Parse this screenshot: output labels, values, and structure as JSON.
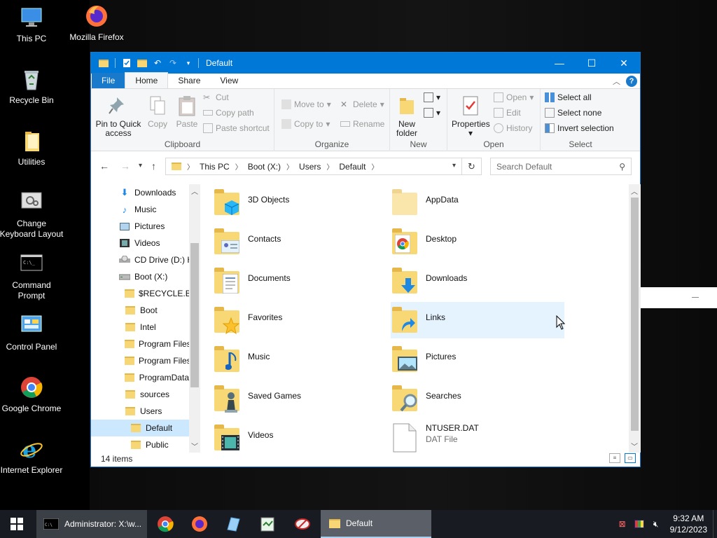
{
  "desktop": {
    "icons": [
      {
        "label": "This PC"
      },
      {
        "label": "Mozilla Firefox"
      },
      {
        "label": "Recycle Bin"
      },
      {
        "label": "Utilities"
      },
      {
        "label": "Change Keyboard Layout"
      },
      {
        "label": "Command Prompt"
      },
      {
        "label": "Control Panel"
      },
      {
        "label": "Google Chrome"
      },
      {
        "label": "Internet Explorer"
      }
    ]
  },
  "window": {
    "title": "Default",
    "controls": {
      "minimize": "—",
      "maximize": "☐",
      "close": "✕"
    }
  },
  "ribbon": {
    "tabs": [
      "File",
      "Home",
      "Share",
      "View"
    ],
    "active_tab": "Home",
    "clipboard": {
      "pin": "Pin to Quick access",
      "pin_line1": "Pin to Quick",
      "pin_line2": "access",
      "copy": "Copy",
      "paste": "Paste",
      "cut": "Cut",
      "copy_path": "Copy path",
      "paste_shortcut": "Paste shortcut",
      "group": "Clipboard"
    },
    "organize": {
      "move_to": "Move to",
      "copy_to": "Copy to",
      "delete": "Delete",
      "rename": "Rename",
      "group": "Organize"
    },
    "new": {
      "new_folder_line1": "New",
      "new_folder_line2": "folder",
      "group": "New"
    },
    "open": {
      "properties": "Properties",
      "open": "Open",
      "edit": "Edit",
      "history": "History",
      "group": "Open"
    },
    "select": {
      "select_all": "Select all",
      "select_none": "Select none",
      "invert": "Invert selection",
      "group": "Select"
    }
  },
  "address": {
    "crumbs": [
      "This PC",
      "Boot (X:)",
      "Users",
      "Default"
    ],
    "search_placeholder": "Search Default"
  },
  "nav_pane": {
    "items": [
      {
        "label": "Downloads",
        "icon": "download-arrow"
      },
      {
        "label": "Music",
        "icon": "music-note"
      },
      {
        "label": "Pictures",
        "icon": "picture"
      },
      {
        "label": "Videos",
        "icon": "film"
      },
      {
        "label": "CD Drive (D:) H",
        "icon": "cd-drive"
      },
      {
        "label": "Boot (X:)",
        "icon": "drive"
      },
      {
        "label": "$RECYCLE.BIN",
        "icon": "folder"
      },
      {
        "label": "Boot",
        "icon": "folder"
      },
      {
        "label": "Intel",
        "icon": "folder"
      },
      {
        "label": "Program Files",
        "icon": "folder"
      },
      {
        "label": "Program Files",
        "icon": "folder"
      },
      {
        "label": "ProgramData",
        "icon": "folder"
      },
      {
        "label": "sources",
        "icon": "folder"
      },
      {
        "label": "Users",
        "icon": "folder"
      },
      {
        "label": "Default",
        "icon": "folder",
        "selected": true
      },
      {
        "label": "Public",
        "icon": "folder"
      }
    ]
  },
  "content": {
    "items": [
      {
        "name": "3D Objects",
        "overlay": "cube"
      },
      {
        "name": "AppData",
        "overlay": "none"
      },
      {
        "name": "Contacts",
        "overlay": "contact-card"
      },
      {
        "name": "Desktop",
        "overlay": "chrome"
      },
      {
        "name": "Documents",
        "overlay": "document"
      },
      {
        "name": "Downloads",
        "overlay": "download-arrow"
      },
      {
        "name": "Favorites",
        "overlay": "star"
      },
      {
        "name": "Links",
        "overlay": "shortcut-arrow"
      },
      {
        "name": "Music",
        "overlay": "music-note"
      },
      {
        "name": "Pictures",
        "overlay": "picture"
      },
      {
        "name": "Saved Games",
        "overlay": "chess-piece"
      },
      {
        "name": "Searches",
        "overlay": "magnifier"
      },
      {
        "name": "Videos",
        "overlay": "film"
      },
      {
        "name": "NTUSER.DAT",
        "overlay": "file",
        "type": "DAT File"
      }
    ]
  },
  "status": {
    "count": "14 items"
  },
  "taskbar": {
    "cmd_label": "Administrator: X:\\w...",
    "explorer_label": "Default",
    "time": "9:32 AM",
    "date": "9/12/2023"
  },
  "colors": {
    "titlebar": "#0078d7",
    "selection": "#cce8ff",
    "hover": "#e5f3ff",
    "folder": "#f8d775"
  }
}
